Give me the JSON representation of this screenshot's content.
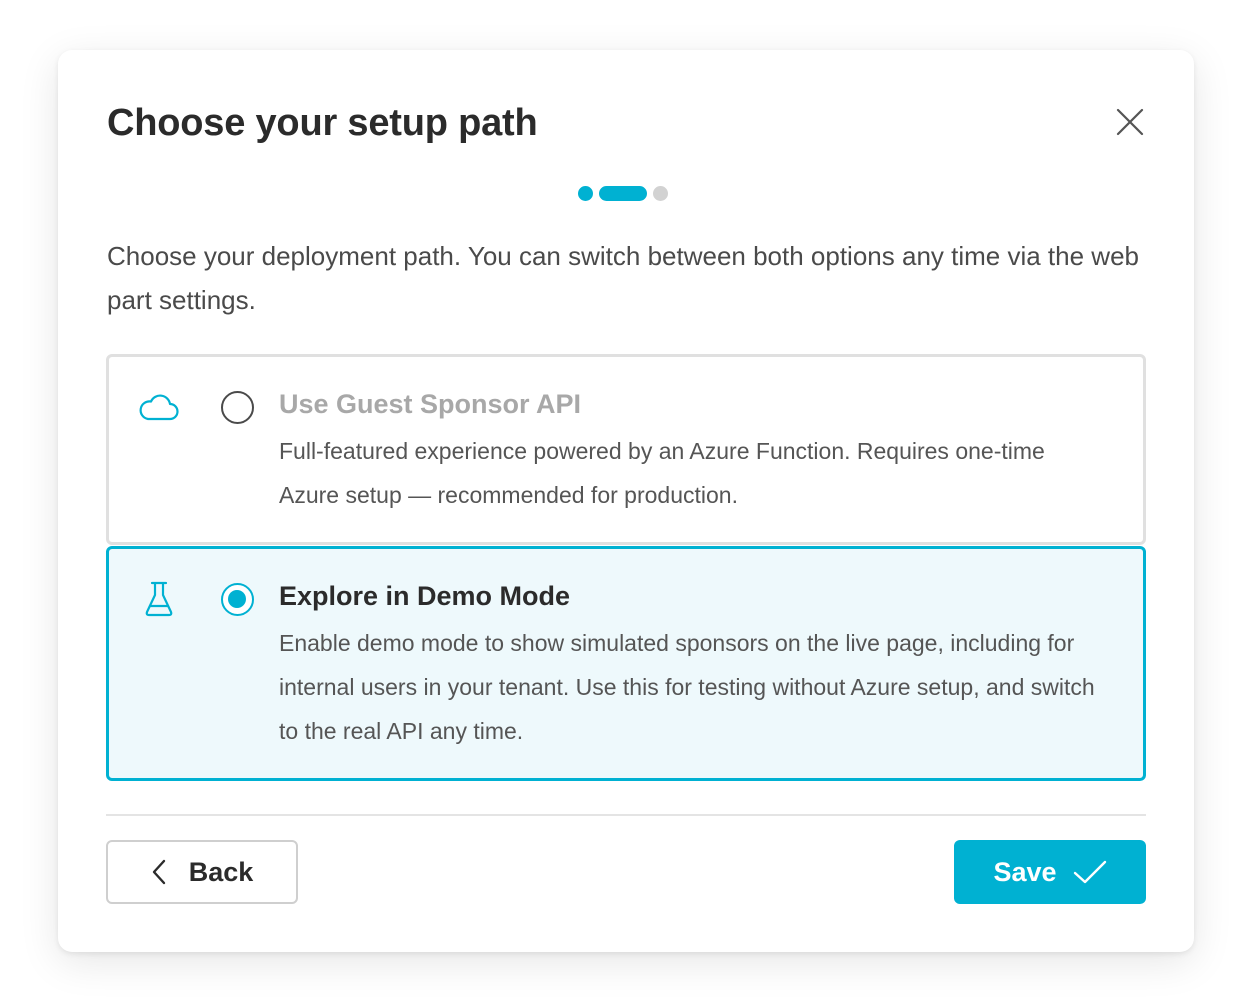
{
  "dialog": {
    "title": "Choose your setup path",
    "close_icon": "close-icon",
    "stepper": {
      "total_steps": 3,
      "current_step": 2
    },
    "intro": "Choose your deployment path. You can switch between both options any time via the web part settings."
  },
  "options": [
    {
      "icon": "cloud-icon",
      "title": "Use Guest Sponsor API",
      "description": "Full-featured experience powered by an Azure Function. Requires one-time Azure setup — recommended for production.",
      "selected": false
    },
    {
      "icon": "flask-icon",
      "title": "Explore in Demo Mode",
      "description": "Enable demo mode to show simulated sponsors on the live page, including for internal users in your tenant. Use this for testing without Azure setup, and switch to the real API any time.",
      "selected": true
    }
  ],
  "footer": {
    "back_label": "Back",
    "back_icon": "chevron-left-icon",
    "save_label": "Save",
    "save_icon": "checkmark-icon"
  },
  "colors": {
    "accent": "#00b1d2",
    "selected_background": "#eef9fc",
    "inactive_step": "#d2d2d2"
  }
}
